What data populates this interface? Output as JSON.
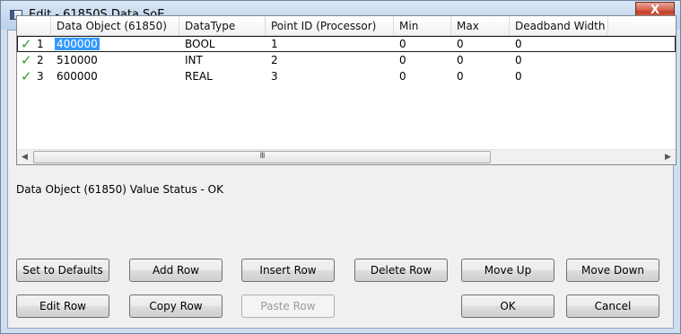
{
  "window": {
    "title": "Edit - 61850S Data SoE",
    "close_glyph": "X"
  },
  "grid": {
    "columns": [
      {
        "label": ""
      },
      {
        "label": "Data Object (61850)"
      },
      {
        "label": "DataType"
      },
      {
        "label": "Point ID (Processor)"
      },
      {
        "label": "Min"
      },
      {
        "label": "Max"
      },
      {
        "label": "Deadband Width"
      }
    ],
    "rows": [
      {
        "index": "1",
        "data_object": "400000",
        "datatype": "BOOL",
        "point_id": "1",
        "min": "0",
        "max": "0",
        "deadband": "0"
      },
      {
        "index": "2",
        "data_object": "510000",
        "datatype": "INT",
        "point_id": "2",
        "min": "0",
        "max": "0",
        "deadband": "0"
      },
      {
        "index": "3",
        "data_object": "600000",
        "datatype": "REAL",
        "point_id": "3",
        "min": "0",
        "max": "0",
        "deadband": "0"
      }
    ],
    "scroll_left_glyph": "◀",
    "scroll_right_glyph": "▶",
    "scroll_thumb_glyph": "III"
  },
  "status_message": "Data Object (61850) Value Status - OK",
  "buttons": {
    "set_defaults": "Set to Defaults",
    "add_row": "Add Row",
    "insert_row": "Insert Row",
    "delete_row": "Delete Row",
    "move_up": "Move Up",
    "move_down": "Move Down",
    "edit_row": "Edit Row",
    "copy_row": "Copy Row",
    "paste_row": "Paste Row",
    "ok": "OK",
    "cancel": "Cancel"
  },
  "colors": {
    "selection": "#3399ff",
    "check": "#2e9a2e",
    "close_button": "#c2402a"
  }
}
